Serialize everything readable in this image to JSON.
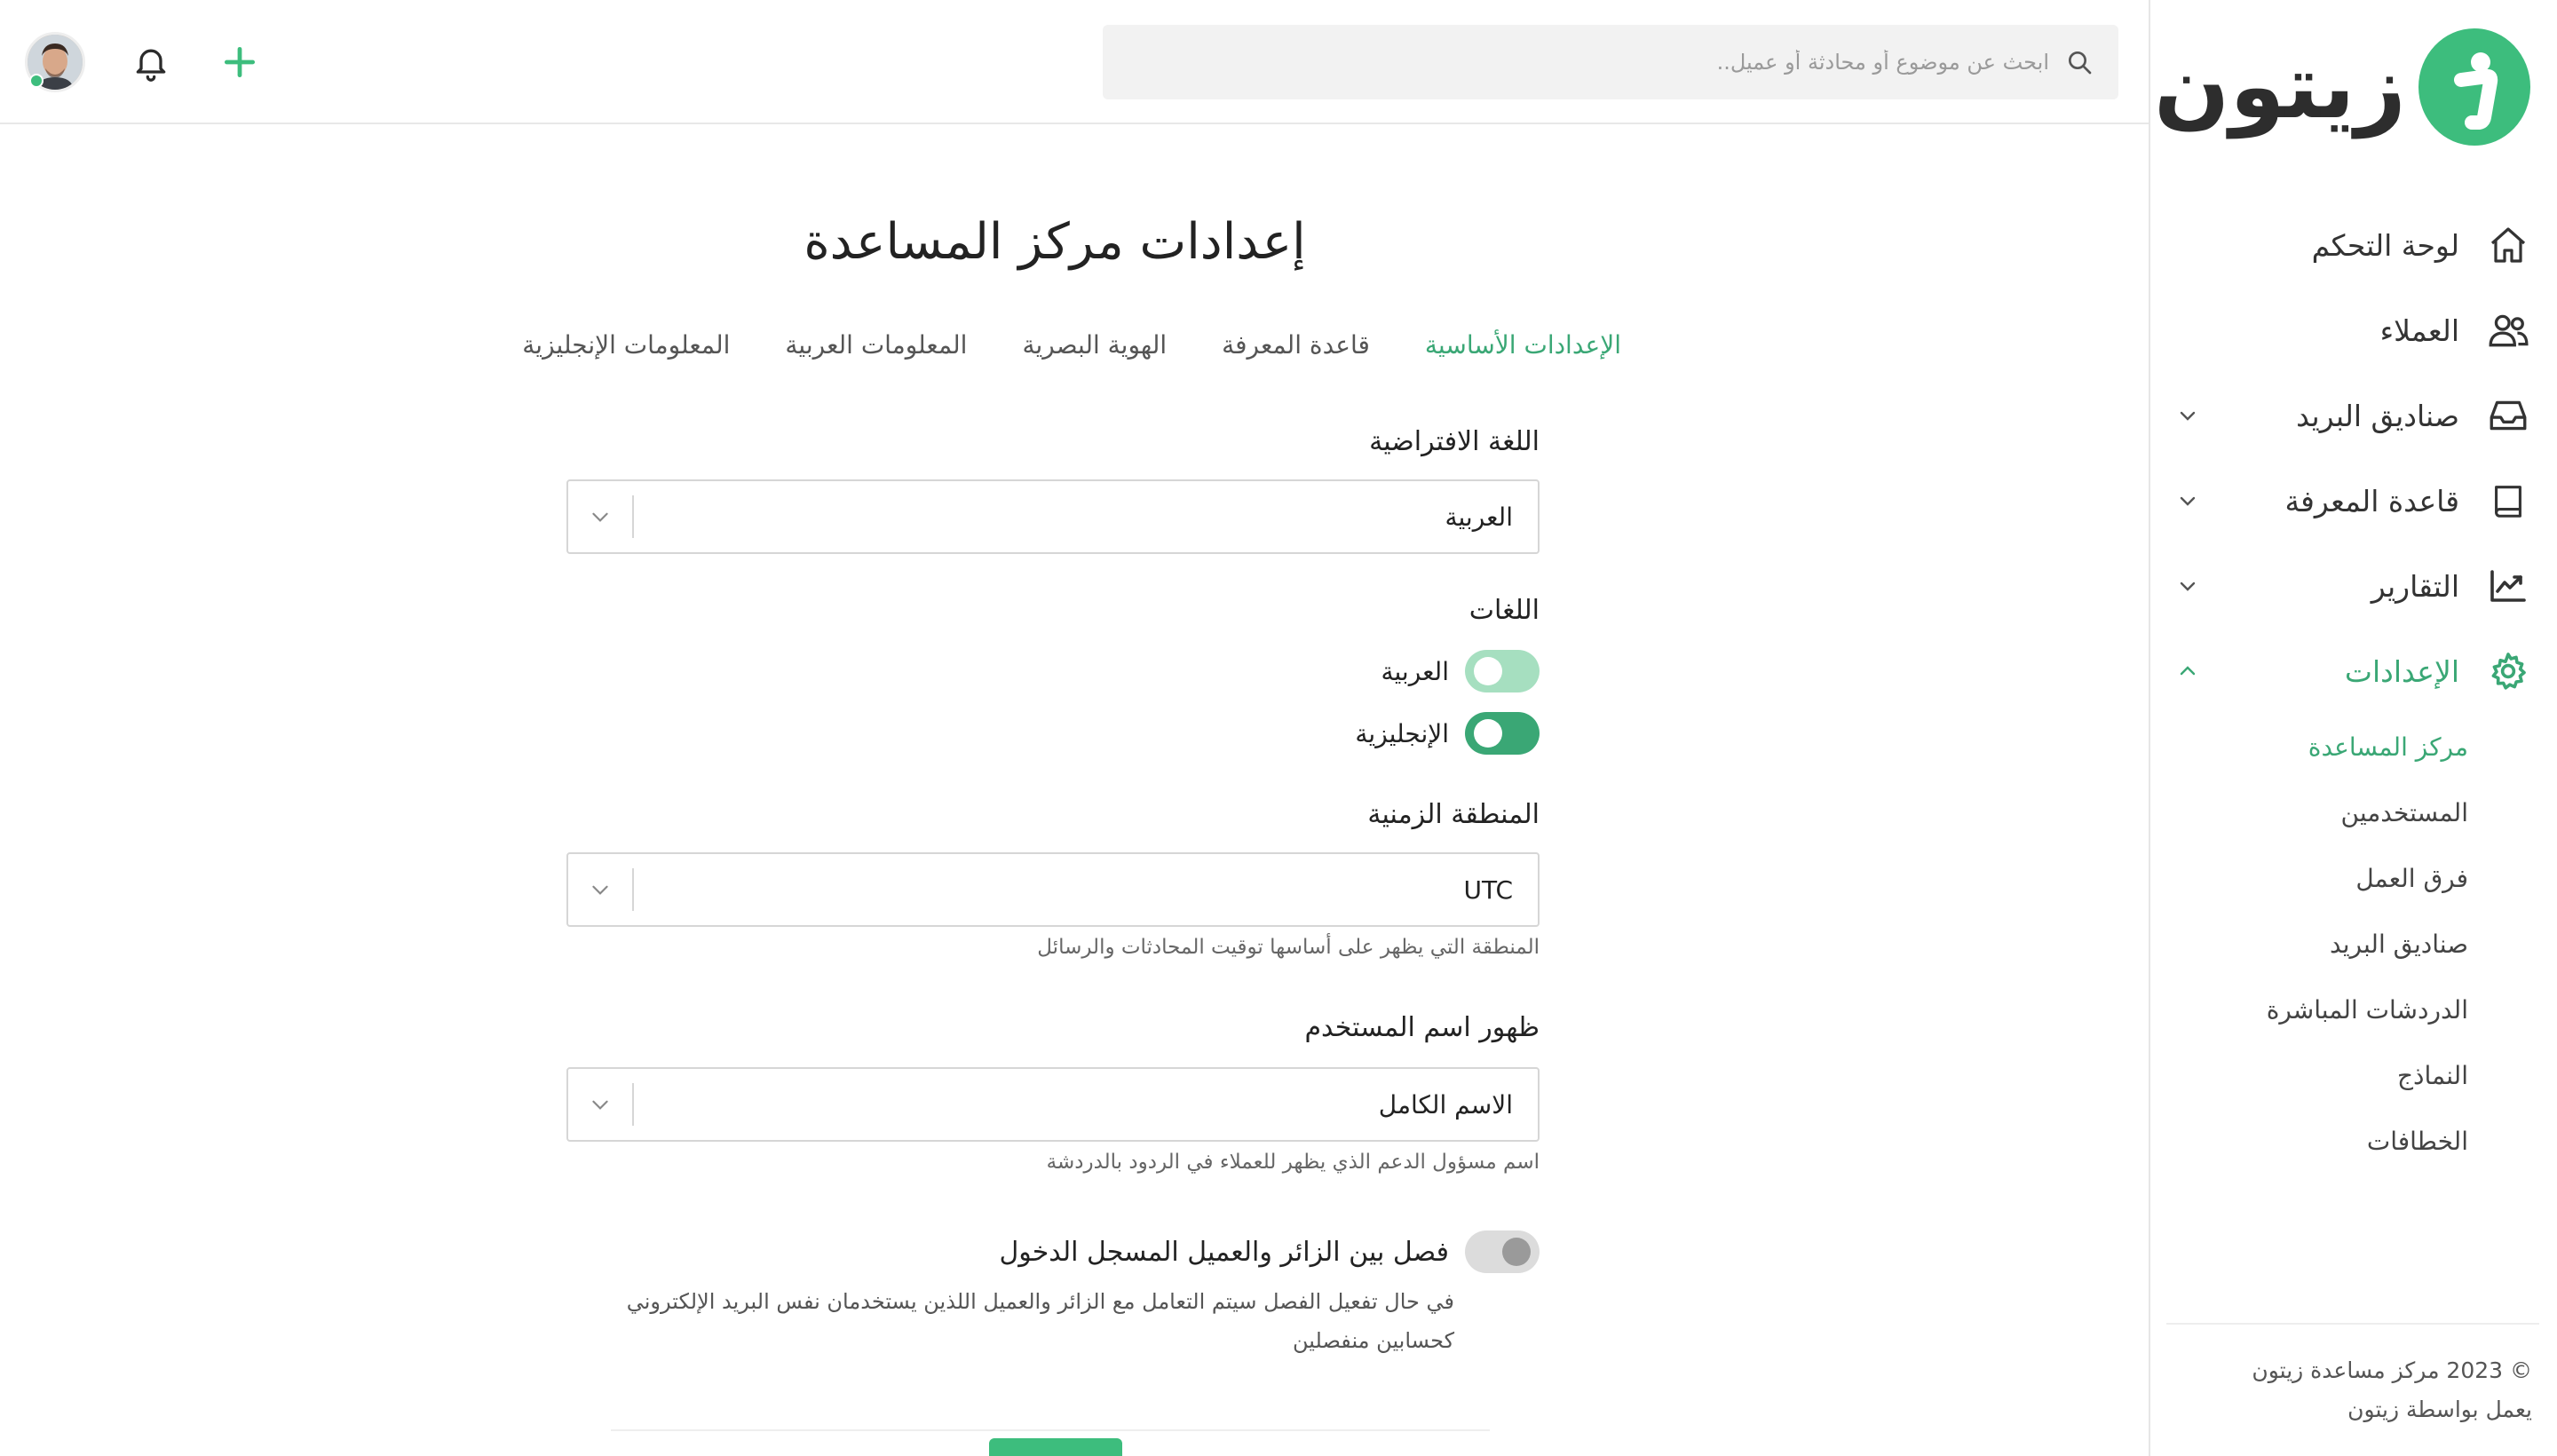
{
  "brand": {
    "name": "زيتون"
  },
  "search": {
    "placeholder": "ابحث عن موضوع أو محادثة أو عميل.."
  },
  "sidebar": {
    "items": [
      {
        "label": "لوحة التحكم",
        "icon": "home-icon"
      },
      {
        "label": "العملاء",
        "icon": "users-icon"
      },
      {
        "label": "صناديق البريد",
        "icon": "inbox-icon"
      },
      {
        "label": "قاعدة المعرفة",
        "icon": "book-icon"
      },
      {
        "label": "التقارير",
        "icon": "chart-icon"
      },
      {
        "label": "الإعدادات",
        "icon": "gear-icon"
      }
    ],
    "sub_items": [
      {
        "label": "مركز المساعدة"
      },
      {
        "label": "المستخدمين"
      },
      {
        "label": "فرق العمل"
      },
      {
        "label": "صناديق البريد"
      },
      {
        "label": "الدردشات المباشرة"
      },
      {
        "label": "النماذج"
      },
      {
        "label": "الخطافات"
      }
    ],
    "footer": {
      "copyright": "© 2023 مركز مساعدة زيتون",
      "powered": "يعمل بواسطة زيتون"
    }
  },
  "page": {
    "title": "إعدادات مركز المساعدة",
    "tabs": [
      {
        "label": "الإعدادات الأساسية"
      },
      {
        "label": "قاعدة المعرفة"
      },
      {
        "label": "الهوية البصرية"
      },
      {
        "label": "المعلومات العربية"
      },
      {
        "label": "المعلومات الإنجليزية"
      }
    ]
  },
  "form": {
    "default_language": {
      "label": "اللغة الافتراضية",
      "value": "العربية"
    },
    "languages": {
      "label": "اللغات",
      "options": [
        {
          "label": "العربية"
        },
        {
          "label": "الإنجليزية"
        }
      ]
    },
    "timezone": {
      "label": "المنطقة الزمنية",
      "value": "UTC",
      "help": "المنطقة التي يظهر على أساسها توقيت المحادثات والرسائل"
    },
    "username_display": {
      "label": "ظهور اسم المستخدم",
      "value": "الاسم الكامل",
      "help": "اسم مسؤول الدعم الذي يظهر للعملاء في الردود بالدردشة"
    },
    "separate_visitor": {
      "label": "فصل بين الزائر والعميل المسجل الدخول",
      "desc_line1": "في حال تفعيل الفصل سيتم التعامل مع الزائر والعميل اللذين يستخدمان نفس البريد الإلكتروني",
      "desc_line2": "كحسابين منفصلين"
    }
  },
  "colors": {
    "accent": "#3aa775",
    "accent_light": "#a6dfc0",
    "brand": "#3dbd7d"
  }
}
